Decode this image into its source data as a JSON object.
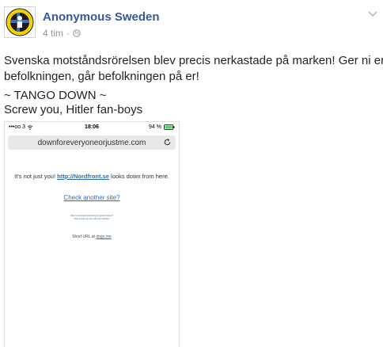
{
  "post": {
    "author": "Anonymous Sweden",
    "time": "4 tim",
    "separator": "·",
    "text_line1": "Svenska motståndsrörelsen blev precis nerkastade på marken! Ger ni er på",
    "text_line2": "befolkningen, går befolkningen på er!",
    "text_line3": "~ TANGO DOWN ~",
    "text_line4": "Screw you, Hitler fan-boys"
  },
  "screenshot": {
    "carrier": "•••oo 3",
    "time": "18:06",
    "battery": "94 %",
    "url": "downforeveryoneorjustme.com",
    "msg_prefix": "It's not just you!",
    "msg_link": "http://Nordfront.se",
    "msg_suffix": "looks down from here.",
    "check_link": "Check another site?",
    "tiny_line1": "Want to download something for global incident?",
    "tiny_line2": "Want to find out more with free visibility?",
    "short_url_label": "Short URL at",
    "short_url_link": "dogo.me"
  },
  "colors": {
    "link": "#365899",
    "meta": "#90949c"
  }
}
